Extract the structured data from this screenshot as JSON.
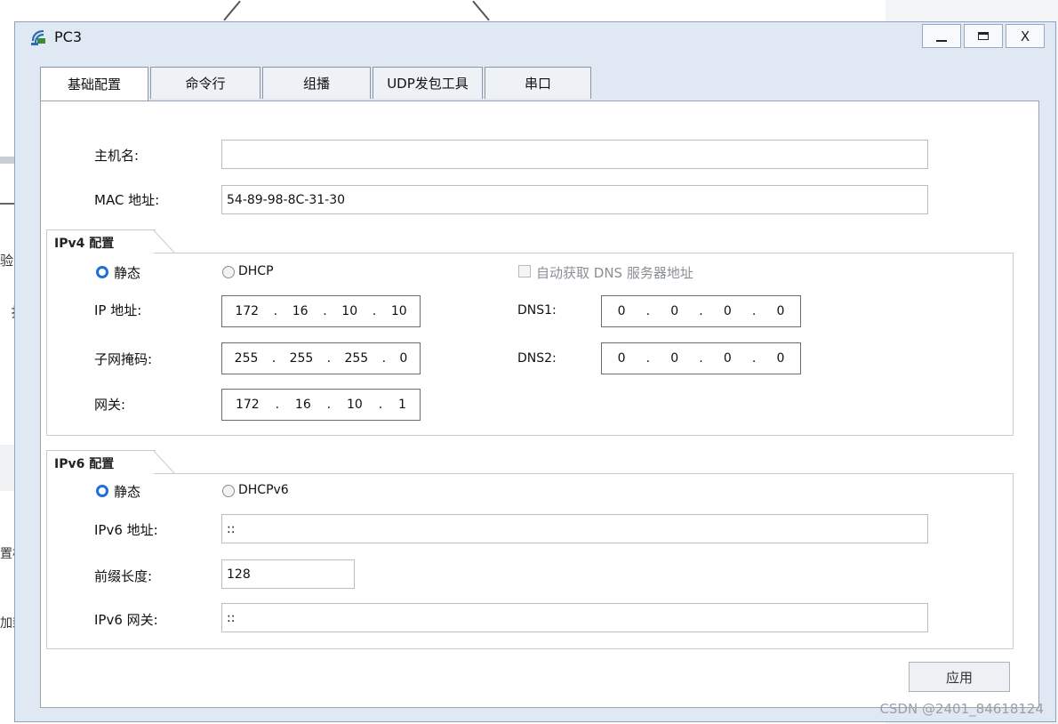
{
  "window": {
    "title": "PC3",
    "controls": {
      "minimize": "_",
      "maximize": "□",
      "close": "X"
    }
  },
  "tabs": [
    {
      "label": "基础配置",
      "active": true
    },
    {
      "label": "命令行",
      "active": false
    },
    {
      "label": "组播",
      "active": false
    },
    {
      "label": "UDP发包工具",
      "active": false
    },
    {
      "label": "串口",
      "active": false
    }
  ],
  "basic": {
    "hostname_label": "主机名:",
    "hostname_value": "",
    "mac_label": "MAC 地址:",
    "mac_value": "54-89-98-8C-31-30"
  },
  "ipv4": {
    "group_title": "IPv4 配置",
    "static_label": "静态",
    "dhcp_label": "DHCP",
    "mode": "static",
    "auto_dns_label": "自动获取 DNS 服务器地址",
    "ip_label": "IP 地址:",
    "ip": [
      "172",
      "16",
      "10",
      "10"
    ],
    "mask_label": "子网掩码:",
    "mask": [
      "255",
      "255",
      "255",
      "0"
    ],
    "gateway_label": "网关:",
    "gateway": [
      "172",
      "16",
      "10",
      "1"
    ],
    "dns1_label": "DNS1:",
    "dns1": [
      "0",
      "0",
      "0",
      "0"
    ],
    "dns2_label": "DNS2:",
    "dns2": [
      "0",
      "0",
      "0",
      "0"
    ]
  },
  "ipv6": {
    "group_title": "IPv6 配置",
    "static_label": "静态",
    "dhcp_label": "DHCPv6",
    "mode": "static",
    "addr_label": "IPv6 地址:",
    "addr_value": "::",
    "prefix_label": "前缀长度:",
    "prefix_value": "128",
    "gateway_label": "IPv6 网关:",
    "gateway_value": "::"
  },
  "apply_label": "应用",
  "watermark": "CSDN @2401_84618124",
  "background_fragments": [
    "验",
    "扌",
    "置板",
    "加封"
  ],
  "colors": {
    "accent": "#1e6fd9",
    "window_bg": "#dfe8f3"
  }
}
